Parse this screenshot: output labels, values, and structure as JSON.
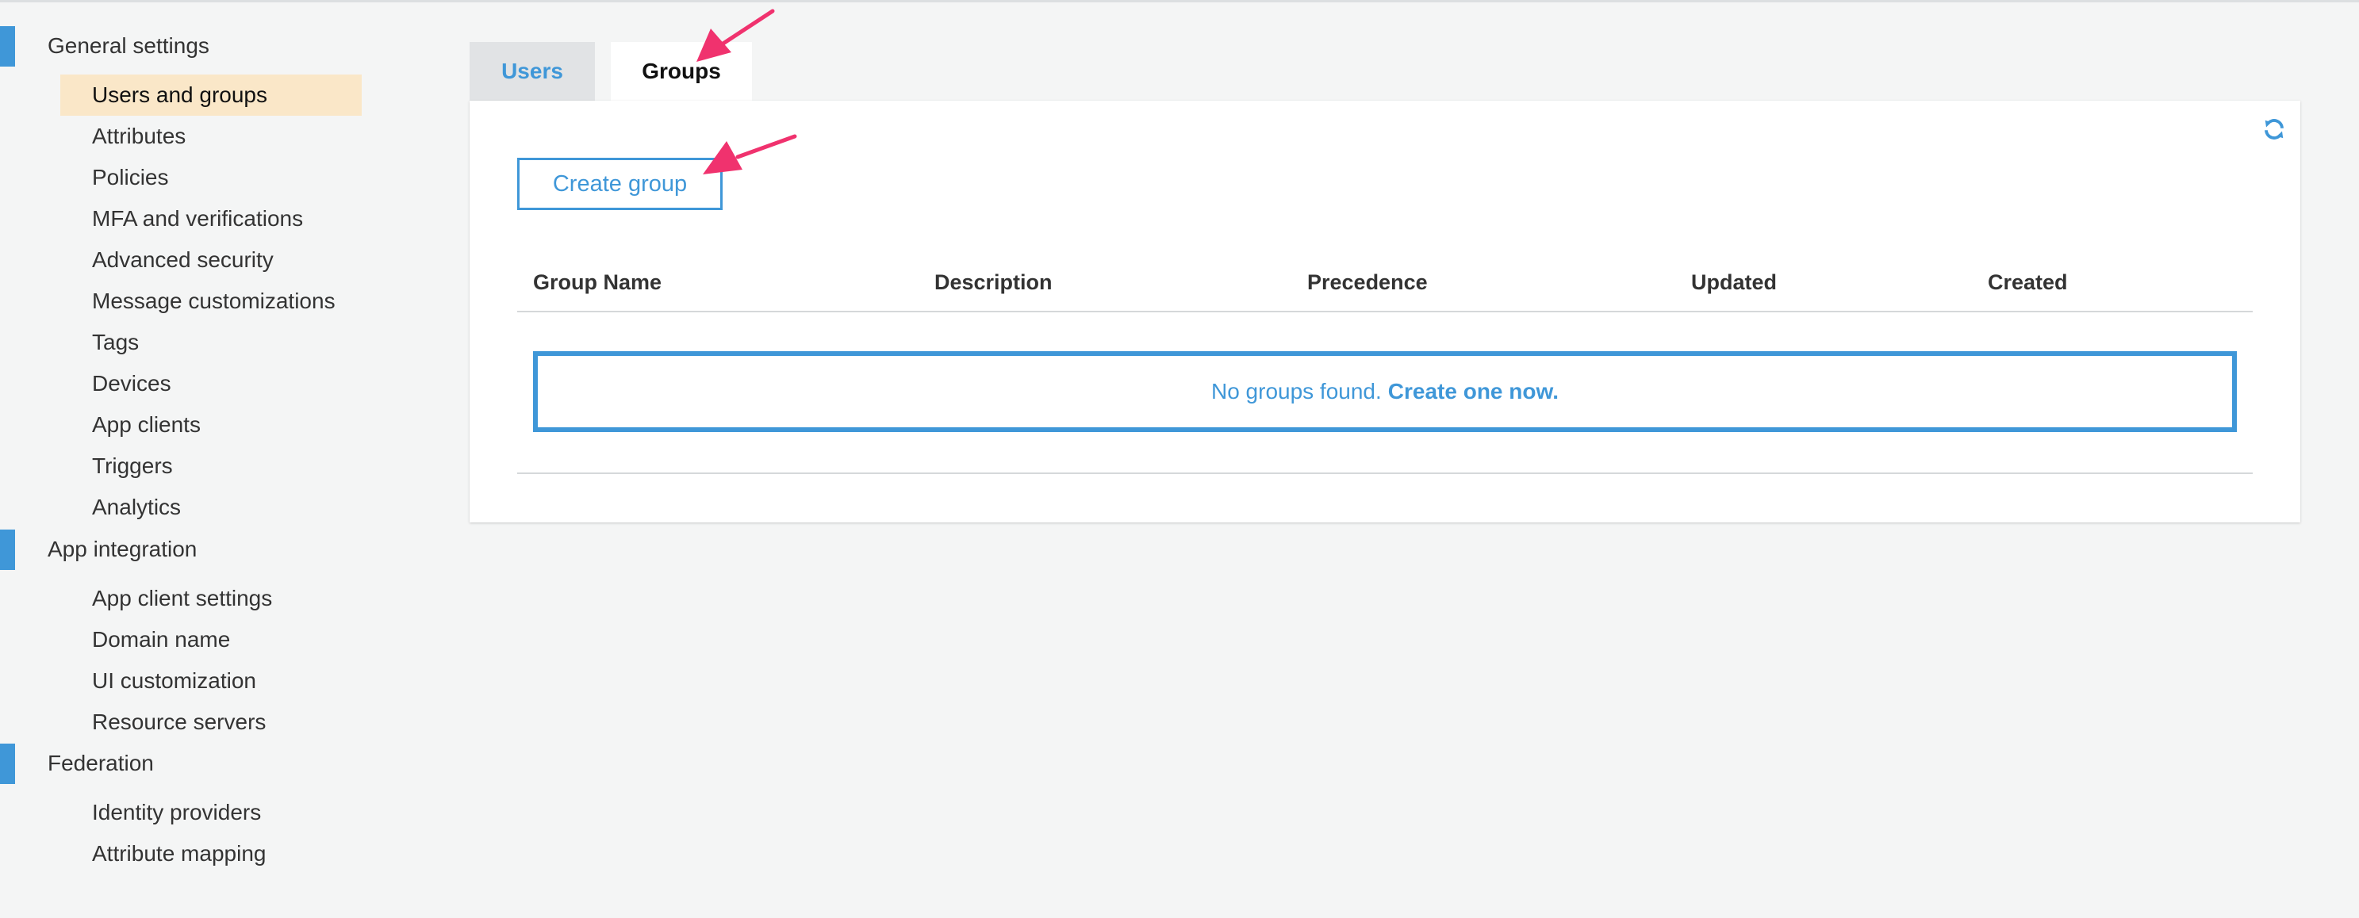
{
  "sidebar": {
    "sections": [
      {
        "title": "General settings",
        "items": [
          {
            "label": "Users and groups",
            "active": true
          },
          {
            "label": "Attributes"
          },
          {
            "label": "Policies"
          },
          {
            "label": "MFA and verifications"
          },
          {
            "label": "Advanced security"
          },
          {
            "label": "Message customizations"
          },
          {
            "label": "Tags"
          },
          {
            "label": "Devices"
          },
          {
            "label": "App clients"
          },
          {
            "label": "Triggers"
          },
          {
            "label": "Analytics"
          }
        ]
      },
      {
        "title": "App integration",
        "items": [
          {
            "label": "App client settings"
          },
          {
            "label": "Domain name"
          },
          {
            "label": "UI customization"
          },
          {
            "label": "Resource servers"
          }
        ]
      },
      {
        "title": "Federation",
        "items": [
          {
            "label": "Identity providers"
          },
          {
            "label": "Attribute mapping"
          }
        ]
      }
    ]
  },
  "tabs": [
    {
      "label": "Users",
      "active": false
    },
    {
      "label": "Groups",
      "active": true
    }
  ],
  "panel": {
    "create_button": "Create group",
    "refresh_icon": "refresh-icon",
    "table": {
      "columns": [
        "Group Name",
        "Description",
        "Precedence",
        "Updated",
        "Created"
      ]
    },
    "empty": {
      "message": "No groups found.",
      "link": "Create one now."
    }
  },
  "colors": {
    "accent": "#3f97d8",
    "active_nav_bg": "#fae7c8",
    "annotation_arrow": "#f0326e"
  }
}
